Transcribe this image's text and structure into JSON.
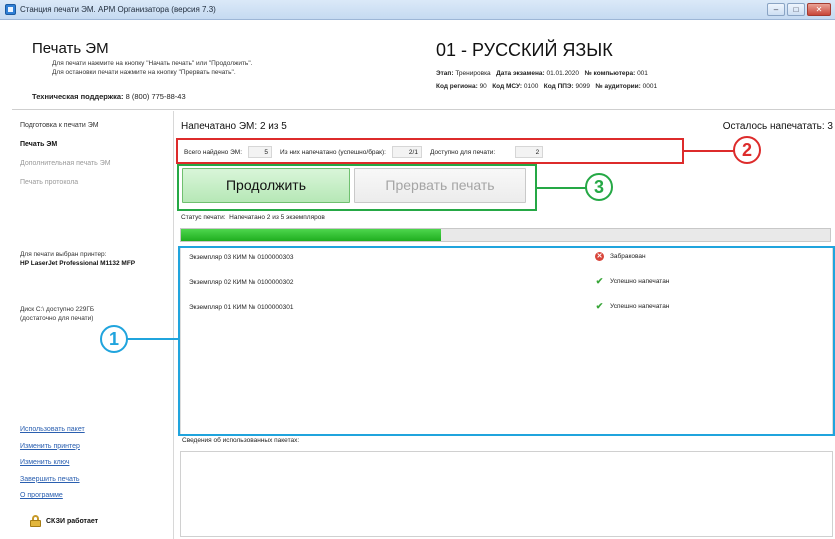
{
  "window": {
    "title": "Станция печати ЭМ. АРМ Организатора (версия 7.3)",
    "min_label": "–",
    "max_label": "□",
    "close_label": "✕"
  },
  "header": {
    "title": "Печать ЭМ",
    "hint_line1": "Для печати нажмите на кнопку \"Начать печать\" или \"Продолжить\".",
    "hint_line2": "Для остановки печати нажмите на кнопку \"Прервать печать\".",
    "support_label": "Техническая поддержка:",
    "support_phone": "8 (800) 775-88-43",
    "subject": "01 - РУССКИЙ ЯЗЫК",
    "stage_label": "Этап:",
    "stage_value": "Тренировка",
    "exam_date_label": "Дата экзамена:",
    "exam_date_value": "01.01.2020",
    "computer_label": "№ компьютера:",
    "computer_value": "001",
    "region_label": "Код региона:",
    "region_value": "90",
    "msu_label": "Код МСУ:",
    "msu_value": "0100",
    "ppe_label": "Код ППЭ:",
    "ppe_value": "9099",
    "room_label": "№ аудитории:",
    "room_value": "0001"
  },
  "sidebar": {
    "nav": [
      {
        "label": "Подготовка к печати ЭМ",
        "state": "normal"
      },
      {
        "label": "Печать ЭМ",
        "state": "active"
      },
      {
        "label": "Дополнительная печать ЭМ",
        "state": "disabled"
      },
      {
        "label": "Печать протокола",
        "state": "disabled"
      }
    ],
    "printer_label": "Для печати выбран принтер:",
    "printer_name": "HP LaserJet Professional M1132 MFP",
    "disk_line1": "Диск C:\\ доступно 229ГБ",
    "disk_line2": "(достаточно для печати)",
    "links": [
      "Использовать пакет",
      "Изменить принтер",
      "Изменить ключ",
      "Завершить печать",
      "О программе"
    ],
    "skzi_status": "СКЗИ работает"
  },
  "main": {
    "printed_text": "Напечатано ЭМ:  2  из  5",
    "remaining_text": "Осталось напечатать:  3",
    "counters": {
      "found_label": "Всего найдено ЭМ:",
      "found_value": "5",
      "printed_label": "Из них напечатано (успешно/брак):",
      "printed_value": "2/1",
      "available_label": "Доступно для печати:",
      "available_value": "2"
    },
    "continue_label": "Продолжить",
    "stop_label": "Прервать печать",
    "status_label": "Статус печати:",
    "status_value": "Напечатано 2 из 5 экземпляров",
    "progress_fraction": 0.4,
    "copies": [
      {
        "name": "Экземпляр 03  КИМ № 0100000303",
        "status": "Забракован",
        "icon": "reject-icon"
      },
      {
        "name": "Экземпляр 02  КИМ № 0100000302",
        "status": "Успешно напечатан",
        "icon": "check-icon"
      },
      {
        "name": "Экземпляр 01  КИМ № 0100000301",
        "status": "Успешно напечатан",
        "icon": "check-icon"
      }
    ],
    "used_packages_label": "Сведения об использованных пакетах:"
  },
  "annotations": {
    "blue_number": "1",
    "red_number": "2",
    "green_number": "3",
    "blue_color": "#20a4dd",
    "red_color": "#dd2b2b",
    "green_color": "#25a845"
  }
}
